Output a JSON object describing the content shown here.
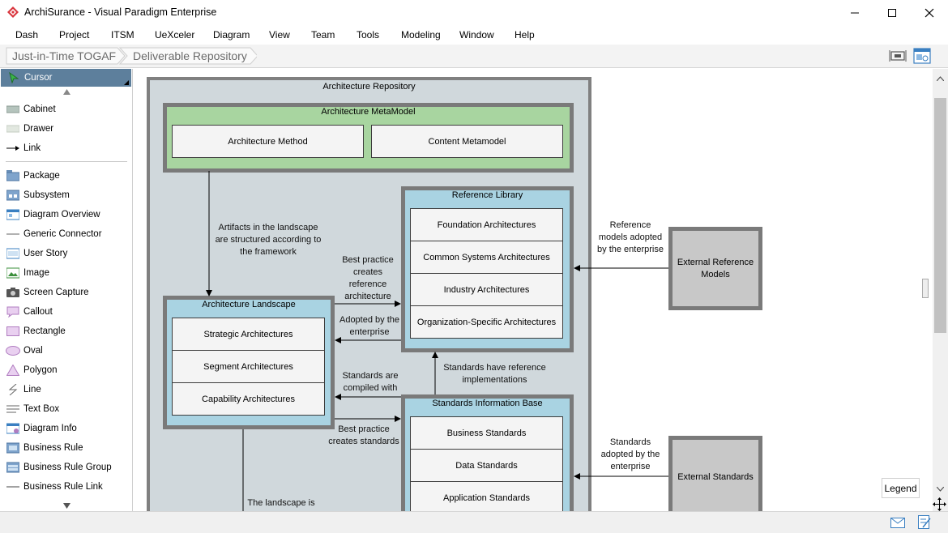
{
  "window": {
    "title": "ArchiSurance - Visual Paradigm Enterprise",
    "controls": [
      "minimize",
      "maximize",
      "close"
    ]
  },
  "menu": [
    "Dash",
    "Project",
    "ITSM",
    "UeXceler",
    "Diagram",
    "View",
    "Team",
    "Tools",
    "Modeling",
    "Window",
    "Help"
  ],
  "breadcrumb": [
    "Just-in-Time TOGAF",
    "Deliverable Repository"
  ],
  "palette": {
    "cursor": "Cursor",
    "items": [
      "Cabinet",
      "Drawer",
      "Link",
      "Package",
      "Subsystem",
      "Diagram Overview",
      "Generic Connector",
      "User Story",
      "Image",
      "Screen Capture",
      "Callout",
      "Rectangle",
      "Oval",
      "Polygon",
      "Line",
      "Text Box",
      "Diagram Info",
      "Business Rule",
      "Business Rule Group",
      "Business Rule Link"
    ]
  },
  "diagram": {
    "repository": "Architecture Repository",
    "metamodel": {
      "title": "Architecture MetaModel",
      "cells": [
        "Architecture Method",
        "Content Metamodel"
      ]
    },
    "reference_library": {
      "title": "Reference Library",
      "cells": [
        "Foundation Architectures",
        "Common Systems Architectures",
        "Industry Architectures",
        "Organization-Specific Architectures"
      ]
    },
    "landscape": {
      "title": "Architecture Landscape",
      "cells": [
        "Strategic Architectures",
        "Segment Architectures",
        "Capability Architectures"
      ]
    },
    "standards_base": {
      "title": "Standards Information Base",
      "cells": [
        "Business Standards",
        "Data Standards",
        "Application Standards"
      ]
    },
    "external_reference_models": "External Reference Models",
    "external_standards": "External Standards",
    "labels": {
      "artifacts": "Artifacts in the landscape are structured according to the framework",
      "best_practice_ref": "Best practice creates reference architecture",
      "adopted_enterprise": "Adopted by the enterprise",
      "standards_compiled": "Standards are compiled with",
      "best_practice_std": "Best practice creates standards",
      "standards_reference": "Standards have reference implementations",
      "ref_models_adopted": "Reference models adopted by the enterprise",
      "standards_adopted": "Standards adopted by the enterprise",
      "landscape_is": "The landscape is"
    },
    "legend": "Legend"
  },
  "colors": {
    "repository_fill": "#d0d8dc",
    "metamodel_fill": "#a8d5a0",
    "library_fill": "#a9d3e2",
    "external_fill": "#c8c8c8",
    "palette_selected": "#5d7f9c"
  }
}
